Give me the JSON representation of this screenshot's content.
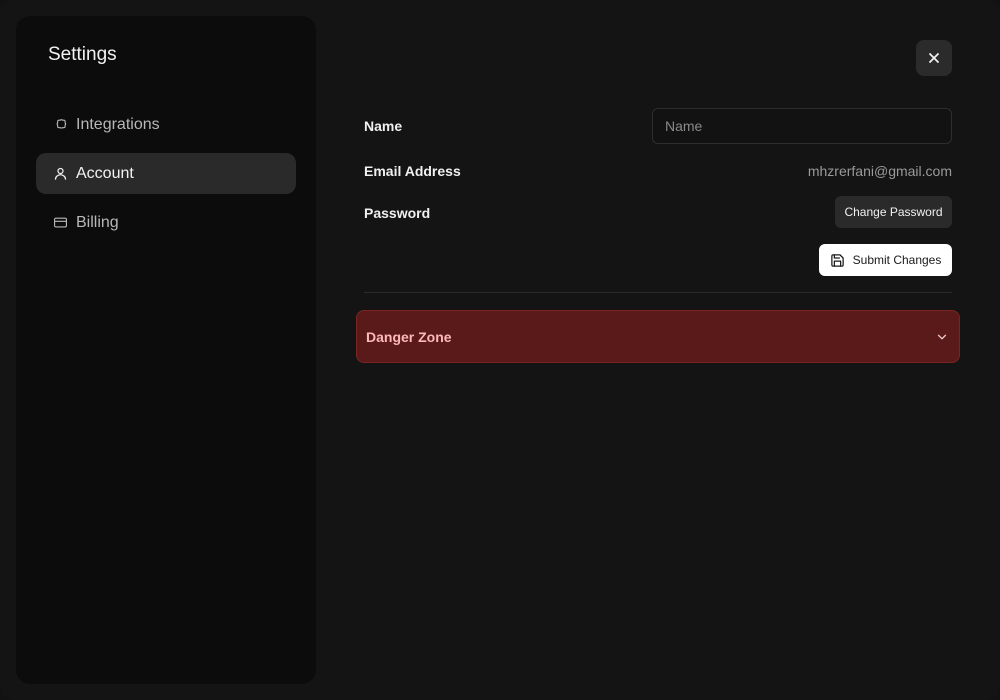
{
  "sidebar": {
    "title": "Settings",
    "items": [
      {
        "label": "Integrations",
        "icon": "puzzle-icon",
        "active": false
      },
      {
        "label": "Account",
        "icon": "user-icon",
        "active": true
      },
      {
        "label": "Billing",
        "icon": "credit-card-icon",
        "active": false
      }
    ]
  },
  "header": {
    "close_icon": "close-icon"
  },
  "account_form": {
    "name_label": "Name",
    "name_value": "",
    "name_placeholder": "Name",
    "email_label": "Email Address",
    "email_value": "mhzrerfani@gmail.com",
    "password_label": "Password",
    "change_password_label": "Change Password",
    "submit_label": "Submit Changes",
    "submit_icon": "save-icon"
  },
  "danger_zone": {
    "label": "Danger Zone",
    "icon": "chevron-down-icon",
    "expanded": false
  },
  "colors": {
    "background": "#141414",
    "sidebar": "#0c0c0c",
    "active_item": "#2a2a2a",
    "danger_bg": "#5a1a1a",
    "danger_text": "#ffb8b8"
  }
}
